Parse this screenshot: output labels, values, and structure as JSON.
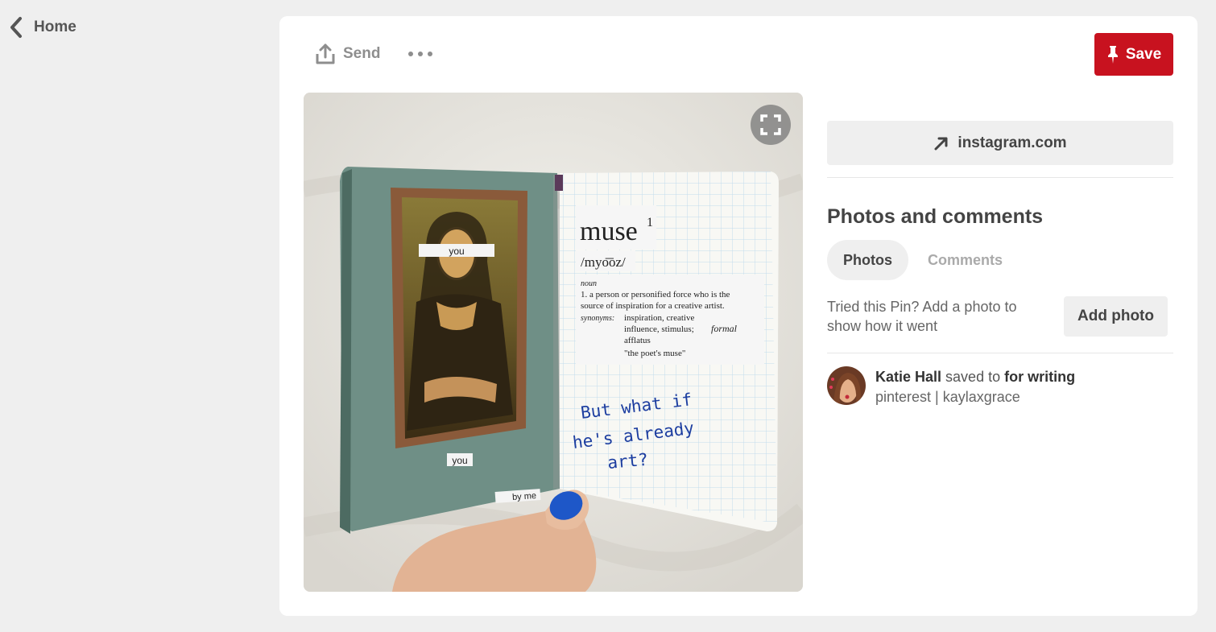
{
  "nav": {
    "home_label": "Home"
  },
  "toolbar": {
    "send_label": "Send",
    "save_label": "Save"
  },
  "pin": {
    "source_label": "instagram.com",
    "image_texts": {
      "you_top": "you",
      "you_bottom": "you",
      "by_me": "by me",
      "headword": "muse",
      "headword_sup": "1",
      "pronunciation": "/myo͞oz/",
      "pos": "noun",
      "def_line1": "1. a person or personified force who is the",
      "def_line2": "source of inspiration for a creative artist.",
      "syn_label": "synonyms:",
      "syn_line1": "inspiration, creative",
      "syn_line2": "influence, stimulus;",
      "syn_formal": "formal",
      "syn_line3": "afflatus",
      "syn_line4": "\"the poet's muse\"",
      "hand_line1": "But what if",
      "hand_line2": "he's already",
      "hand_line3": "art?"
    }
  },
  "photos_comments": {
    "title": "Photos and comments",
    "tabs": [
      "Photos",
      "Comments"
    ],
    "active_tab": "Photos",
    "tried_text": "Tried this Pin? Add a photo to show how it went",
    "add_photo_label": "Add photo"
  },
  "saved_by": {
    "user": "Katie Hall",
    "verb": "saved to",
    "board": "for writing",
    "subtitle": "pinterest | kaylaxgrace"
  },
  "colors": {
    "save_red": "#c8121f",
    "background": "#efefef"
  },
  "icons": [
    "chevron-left-icon",
    "share-upload-icon",
    "more-dots-icon",
    "pin-icon",
    "expand-icon",
    "arrow-up-right-icon"
  ]
}
